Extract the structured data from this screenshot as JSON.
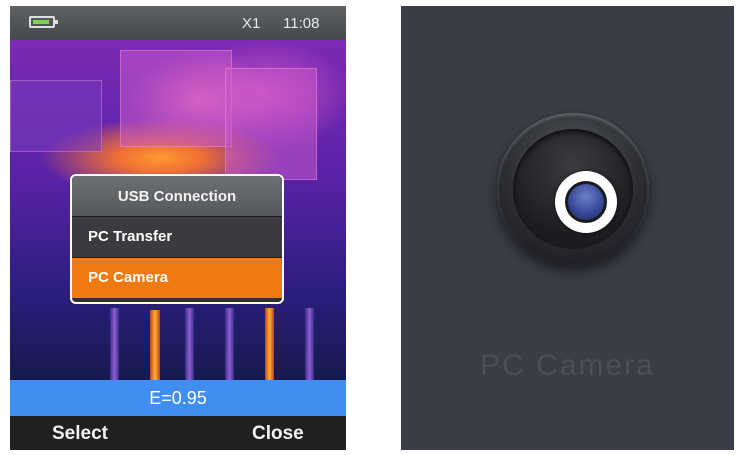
{
  "left_screen": {
    "status": {
      "zoom": "X1",
      "time": "11:08",
      "battery_icon": "battery-icon"
    },
    "menu": {
      "title": "USB Connection",
      "items": [
        {
          "label": "PC Transfer",
          "selected": false
        },
        {
          "label": "PC Camera",
          "selected": true
        }
      ]
    },
    "emissivity": "E=0.95",
    "softkeys": {
      "left": "Select",
      "right": "Close"
    },
    "colors": {
      "selected": "#f07a12",
      "emissivity_bar": "#3f8ef0"
    }
  },
  "right_screen": {
    "icon": "camera-icon",
    "label": "PC Camera",
    "background": "#3a3d46"
  }
}
